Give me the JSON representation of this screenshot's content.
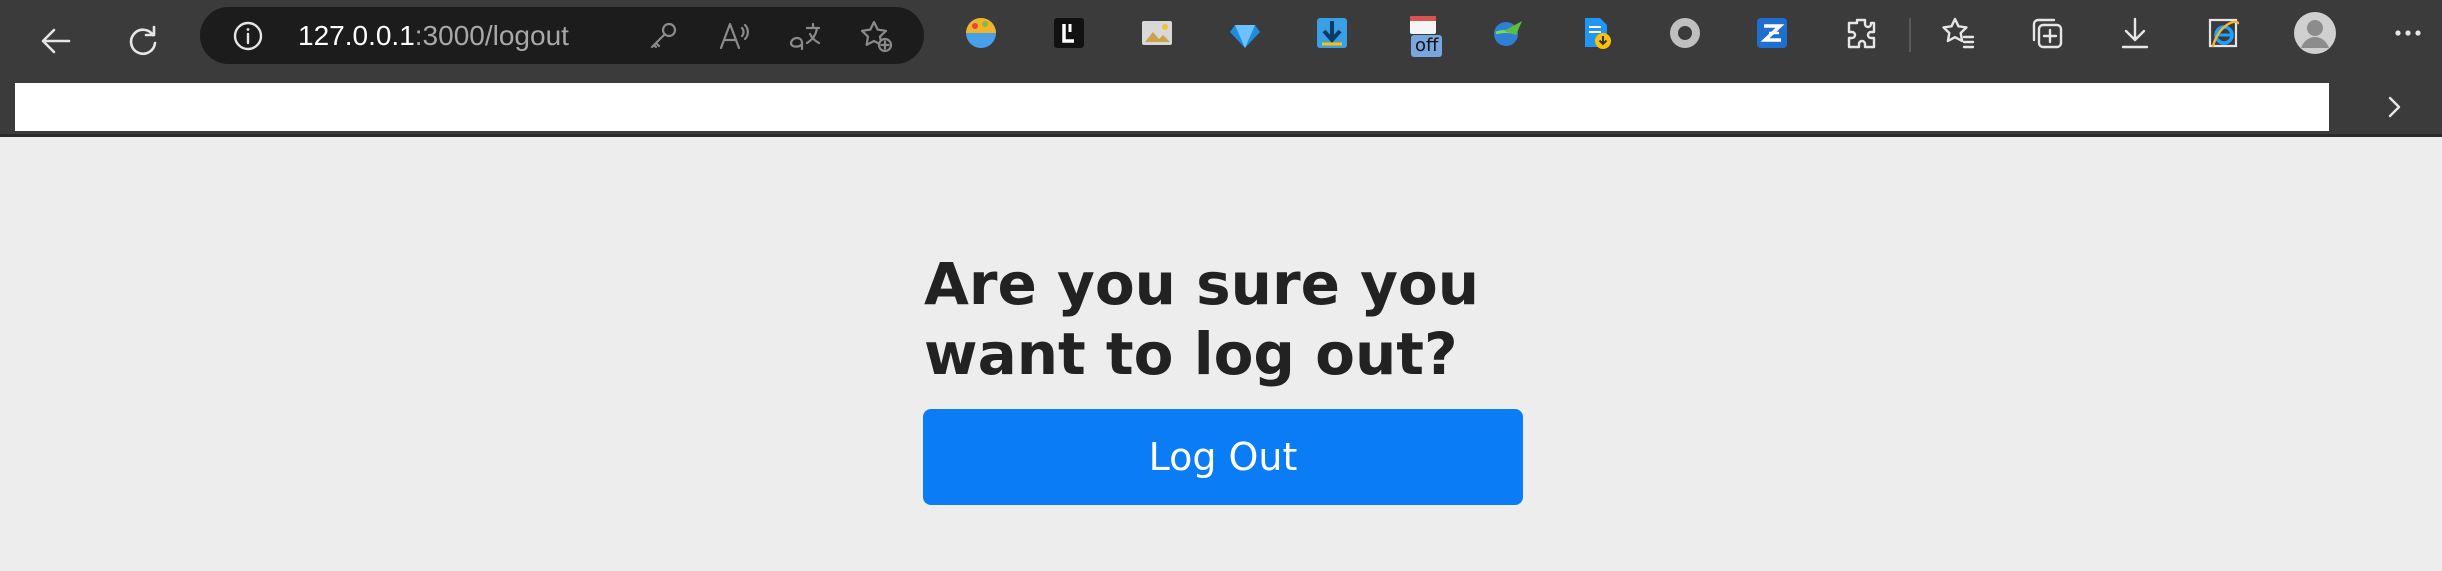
{
  "browser": {
    "address_bar": {
      "url_host": "127.0.0.1",
      "url_rest": ":3000/logout"
    },
    "extension_badge": "off",
    "colors": {
      "toolbar": "#3b3b3b",
      "address_bar": "#1c1c1c",
      "page_background": "#ededed",
      "primary_button": "#0a7cf6"
    },
    "toolbar_icons": [
      "back-icon",
      "refresh-icon",
      "site-info-icon",
      "password-key-icon",
      "read-aloud-icon",
      "translate-icon",
      "add-favorite-icon",
      "extensions-icon",
      "favorites-icon",
      "collections-icon",
      "downloads-icon",
      "internet-explorer-mode-icon",
      "profile-avatar",
      "settings-more-icon"
    ]
  },
  "page": {
    "heading": "Are you sure you want to log out?",
    "logout_button_label": "Log Out"
  }
}
